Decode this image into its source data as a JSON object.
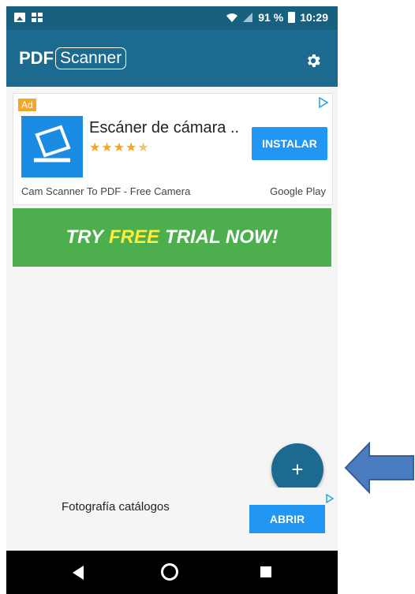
{
  "statusbar": {
    "icons": [
      "gallery-icon",
      "grid-icon",
      "wifi-icon",
      "signal-icon",
      "battery-icon"
    ],
    "battery": "91 %",
    "time": "10:29"
  },
  "appbar": {
    "logo_pdf": "PDF",
    "logo_scanner": "Scanner",
    "settings_icon": "gear-icon"
  },
  "ad": {
    "badge": "Ad",
    "title": "Escáner de cámara ..",
    "rating": 4.5,
    "install_label": "INSTALAR",
    "description": "Cam Scanner To PDF - Free Camera",
    "source": "Google Play"
  },
  "trial": {
    "prefix": "TRY",
    "highlight": "FREE",
    "suffix": "TRIAL NOW!"
  },
  "fab": {
    "label": "+"
  },
  "bottom_ad": {
    "label": "Fotografía catálogos",
    "button": "ABRIR"
  },
  "colors": {
    "appbar": "#1d6a91",
    "statusbar": "#17607f",
    "trial_green": "#4cae4c",
    "button_blue": "#2196f3",
    "free_yellow": "#ffeb3b"
  }
}
